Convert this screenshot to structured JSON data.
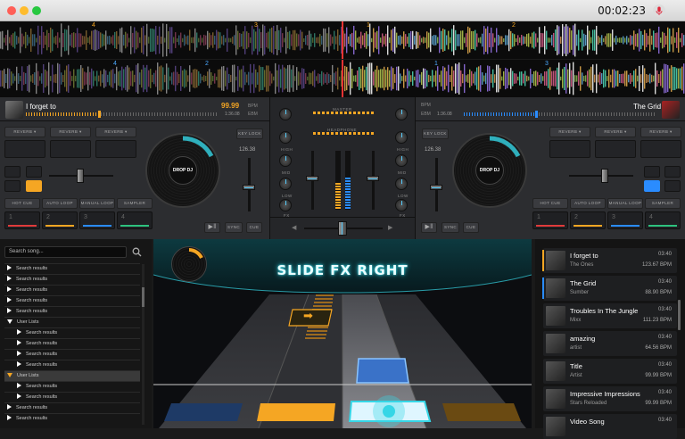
{
  "window": {
    "clock": "00:02:23"
  },
  "icons": {
    "record": "microphone-icon",
    "search": "search-icon"
  },
  "colors": {
    "left_accent": "#f5a623",
    "right_accent": "#2a8cff",
    "cyan": "#36d6e6"
  },
  "waveform": {
    "top_cues": [
      "4",
      "3",
      "1",
      "2"
    ],
    "bottom_cues": [
      "4",
      "2",
      "1",
      "3"
    ]
  },
  "deck_left": {
    "title": "I forget to",
    "bpm_value": "99.99",
    "bpm_label": "BPM",
    "time": "1:36.08",
    "ebm_label": "EBM",
    "effects": [
      "REVERB",
      "REVERB",
      "REVERB"
    ],
    "key_lock": "KEY LOCK",
    "pitch": "126.38",
    "platter_label": "DROP DJ",
    "buttons": [
      "HOT CUE",
      "AUTO LOOP",
      "MANUAL LOOP",
      "SAMPLER"
    ],
    "pads": [
      "1",
      "2",
      "3",
      "4"
    ],
    "play_icon": "play-pause-icon",
    "sync": "SYNC",
    "cue": "CUE"
  },
  "deck_right": {
    "title": "The Grid",
    "bpm_label": "BPM",
    "ebm_label": "EBM",
    "time": "1:36.08",
    "effects": [
      "REVERB",
      "REVERB",
      "REVERB"
    ],
    "key_lock": "KEY LOCK",
    "pitch": "126.38",
    "platter_label": "DROP DJ",
    "buttons": [
      "HOT CUE",
      "AUTO LOOP",
      "MANUAL LOOP",
      "SAMPLER"
    ],
    "pads": [
      "1",
      "2",
      "3",
      "4"
    ],
    "play_icon": "play-pause-icon",
    "sync": "SYNC",
    "cue": "CUE"
  },
  "mixer": {
    "master": "MASTER",
    "headphone": "HEADPHONE",
    "eq_labels": [
      "HIGH",
      "MID",
      "LOW",
      "FX"
    ]
  },
  "browser": {
    "search_placeholder": "Search song...",
    "rows": [
      {
        "label": "Search results",
        "level": 0,
        "expanded": false
      },
      {
        "label": "Search results",
        "level": 0,
        "expanded": false
      },
      {
        "label": "Search results",
        "level": 0,
        "expanded": false
      },
      {
        "label": "Search results",
        "level": 0,
        "expanded": false
      },
      {
        "label": "Search results",
        "level": 0,
        "expanded": false
      },
      {
        "label": "User Lists",
        "level": 0,
        "expanded": true
      },
      {
        "label": "Search results",
        "level": 1,
        "expanded": false
      },
      {
        "label": "Search results",
        "level": 1,
        "expanded": false
      },
      {
        "label": "Search results",
        "level": 1,
        "expanded": false
      },
      {
        "label": "Search results",
        "level": 1,
        "expanded": false
      },
      {
        "label": "User Lists",
        "level": 0,
        "expanded": true,
        "highlight": true
      },
      {
        "label": "Search results",
        "level": 1,
        "expanded": false
      },
      {
        "label": "Search results",
        "level": 1,
        "expanded": false
      },
      {
        "label": "Search results",
        "level": 0,
        "expanded": false
      },
      {
        "label": "Search results",
        "level": 0,
        "expanded": false
      }
    ]
  },
  "game": {
    "instruction": "SLIDE FX RIGHT",
    "arrow_icon": "arrow-right-icon"
  },
  "playlist": [
    {
      "title": "I forget to",
      "artist": "The Ones",
      "duration": "03:40",
      "bpm": "123.67 BPM",
      "marker": "#f5a623"
    },
    {
      "title": "The Grid",
      "artist": "Sumber",
      "duration": "03:40",
      "bpm": "88.90 BPM",
      "marker": "#2a8cff"
    },
    {
      "title": "Troubles In The Jungle",
      "artist": "Mixx",
      "duration": "03:40",
      "bpm": "111.23 BPM",
      "marker": ""
    },
    {
      "title": "amazing",
      "artist": "artist",
      "duration": "03:40",
      "bpm": "64.56 BPM",
      "marker": ""
    },
    {
      "title": "Title",
      "artist": "Artist",
      "duration": "03:40",
      "bpm": "99.99 BPM",
      "marker": ""
    },
    {
      "title": "Impressive Impressions",
      "artist": "Stars Reloaded",
      "duration": "03:40",
      "bpm": "99.99 BPM",
      "marker": ""
    },
    {
      "title": "Video Song",
      "artist": "",
      "duration": "03:40",
      "bpm": "",
      "marker": ""
    }
  ]
}
